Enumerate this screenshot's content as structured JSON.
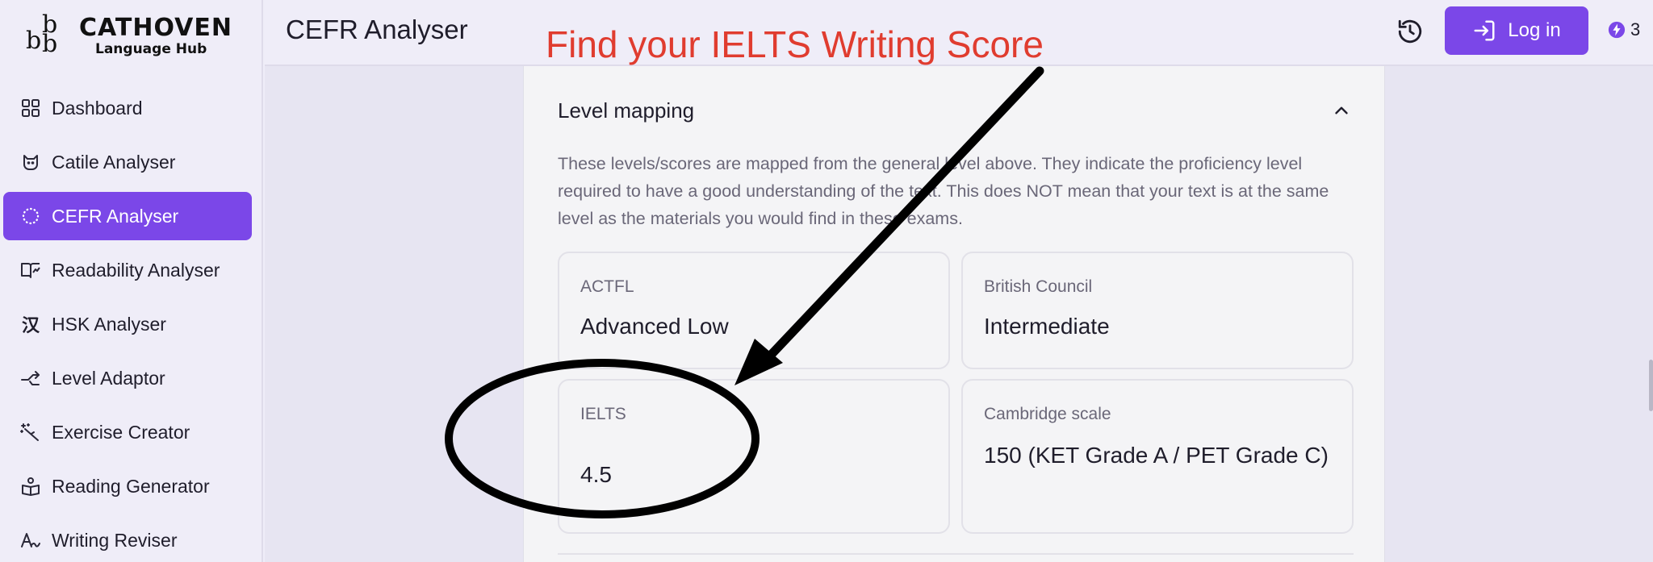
{
  "brand": {
    "name": "CATHOVEN",
    "subtitle": "Language Hub"
  },
  "sidebar": {
    "items": [
      {
        "label": "Dashboard",
        "icon": "grid-icon",
        "active": false
      },
      {
        "label": "Catile Analyser",
        "icon": "cat-icon",
        "active": false
      },
      {
        "label": "CEFR Analyser",
        "icon": "dotted-circle-icon",
        "active": true
      },
      {
        "label": "Readability Analyser",
        "icon": "book-chart-icon",
        "active": false
      },
      {
        "label": "HSK Analyser",
        "icon": "chinese-char-icon",
        "active": false
      },
      {
        "label": "Level Adaptor",
        "icon": "branch-arrow-icon",
        "active": false
      },
      {
        "label": "Exercise Creator",
        "icon": "magic-wand-icon",
        "active": false
      },
      {
        "label": "Reading Generator",
        "icon": "reader-icon",
        "active": false
      },
      {
        "label": "Writing Reviser",
        "icon": "handwriting-icon",
        "active": false
      }
    ]
  },
  "header": {
    "title": "CEFR Analyser",
    "login_label": "Log in",
    "credits": "3"
  },
  "annotation": {
    "text": "Find your IELTS Writing Score",
    "color": "#e03c2f"
  },
  "panel": {
    "title": "Level mapping",
    "description": "These levels/scores are mapped from the general level above. They indicate the proficiency level required to have a good understanding of the text. This does NOT mean that your text is at the same level as the materials you would find in these exams.",
    "cards": [
      {
        "label": "ACTFL",
        "value": "Advanced Low"
      },
      {
        "label": "British Council",
        "value": "Intermediate"
      },
      {
        "label": "IELTS",
        "value": "4.5"
      },
      {
        "label": "Cambridge scale",
        "value": "150 (KET Grade A / PET Grade C)"
      }
    ]
  },
  "colors": {
    "accent": "#7b47e8",
    "sidebar_bg": "#efedf8",
    "panel_bg": "#f4f4f6"
  }
}
